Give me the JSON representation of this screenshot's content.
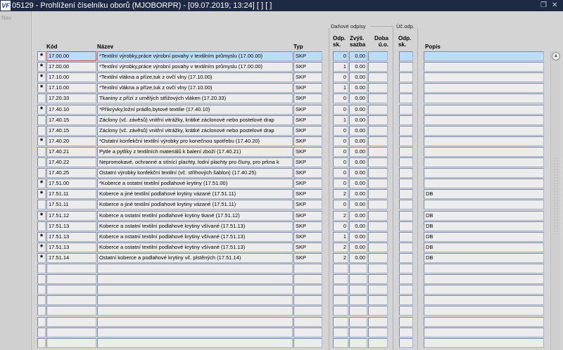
{
  "window": {
    "title": "05129 - Prohlížení číselníku oborů (MJOBORPR) - [09.07.2019; 13:24]  [ ]  [ ]",
    "logo": "VF",
    "restore_icon": "restore-icon",
    "close_icon": "close-icon"
  },
  "nav": {
    "label": "Nav"
  },
  "groups": {
    "danove": "Daňové odpisy",
    "uc": "Úč.odp."
  },
  "columns": {
    "kod": "Kód",
    "nazev": "Název",
    "typ": "Typ",
    "odp1": "Odp.",
    "odp2": "sk.",
    "zvys1": "Zvýš.",
    "zvys2": "sazba",
    "doba1": "Doba",
    "doba2": "ú.o.",
    "ucodp1": "Odp.",
    "ucodp2": "sk.",
    "popis": "Popis"
  },
  "rows": [
    {
      "star": "*",
      "kod": "17.00.00",
      "nazev": "*Textilní výrobky,práce výrobní povahy v textilním průmyslu (17.00.00)",
      "typ": "SKP",
      "odp": "0",
      "zvys": "0.00",
      "popis": ""
    },
    {
      "star": "*",
      "kod": "17.00.00",
      "nazev": "*Textilní výrobky,práce výrobní povahy v textilním průmyslu (17.00.00)",
      "typ": "SKP",
      "odp": "1",
      "zvys": "0.00",
      "popis": ""
    },
    {
      "star": "*",
      "kod": "17.10.00",
      "nazev": "*Textilní vlákna a příze,tuk z ovčí vlny (17.10.00)",
      "typ": "SKP",
      "odp": "0",
      "zvys": "0.00",
      "popis": ""
    },
    {
      "star": "*",
      "kod": "17.10.00",
      "nazev": "*Textilní vlákna a příze,tuk z ovčí vlny (17.10.00)",
      "typ": "SKP",
      "odp": "1",
      "zvys": "0.00",
      "popis": ""
    },
    {
      "star": "",
      "kod": "17.20.33",
      "nazev": "Tkaniny z přízí z umělých střižových vláken (17.20.33)",
      "typ": "SKP",
      "odp": "0",
      "zvys": "0.00",
      "popis": ""
    },
    {
      "star": "*",
      "kod": "17.40.10",
      "nazev": "*Přikrývky,ložní prádlo,bytové textilie (17.40.10)",
      "typ": "SKP",
      "odp": "0",
      "zvys": "0.00",
      "popis": ""
    },
    {
      "star": "",
      "kod": "17.40.15",
      "nazev": "Záclony (vč. závěsů) vnitřní vitrážky, krátké záclonové nebo postelové drap",
      "typ": "SKP",
      "odp": "1",
      "zvys": "0.00",
      "popis": ""
    },
    {
      "star": "",
      "kod": "17.40.15",
      "nazev": "Záclony (vč. závěsů) vnitřní vitrážky, krátké záclonové nebo postelové drap",
      "typ": "SKP",
      "odp": "0",
      "zvys": "0.00",
      "popis": ""
    },
    {
      "star": "*",
      "kod": "17.40.20",
      "nazev": "*Ostatní konfekční textilní výrobky pro konečnou spotřebu (17.40.20)",
      "typ": "SKP",
      "odp": "0",
      "zvys": "0.00",
      "popis": ""
    },
    {
      "star": "",
      "kod": "17.40.21",
      "nazev": "Pytle a pytlíky z textilních materiálů k balení zboží (17.40.21)",
      "typ": "SKP",
      "odp": "0",
      "zvys": "0.00",
      "popis": ""
    },
    {
      "star": "",
      "kod": "17.40.22",
      "nazev": "Nepromokavé, ochranné a stínící plachty, lodní plachty pro čluny, pro prkna k",
      "typ": "SKP",
      "odp": "0",
      "zvys": "0.00",
      "popis": ""
    },
    {
      "star": "",
      "kod": "17.40.25",
      "nazev": "Ostatní výrobky konfekční textilní (vč. střihových šablon) (17.40.25)",
      "typ": "SKP",
      "odp": "0",
      "zvys": "0.00",
      "popis": ""
    },
    {
      "star": "*",
      "kod": "17.51.00",
      "nazev": "*Koberce a ostatní textilní podlahové krytiny (17.51.00)",
      "typ": "SKP",
      "odp": "0",
      "zvys": "0.00",
      "popis": ""
    },
    {
      "star": "*",
      "kod": "17.51.11",
      "nazev": "Koberce a jiné textilní podlahové krytiny vázané (17.51.11)",
      "typ": "SKP",
      "odp": "2",
      "zvys": "0.00",
      "popis": "DB"
    },
    {
      "star": "",
      "kod": "17.51.11",
      "nazev": "Koberce a jiné textilní podlahové krytiny vázané (17.51.11)",
      "typ": "SKP",
      "odp": "0",
      "zvys": "0.00",
      "popis": ""
    },
    {
      "star": "*",
      "kod": "17.51.12",
      "nazev": "Koberce a ostatní textilní podlahové krytiny tkané (17.51.12)",
      "typ": "SKP",
      "odp": "2",
      "zvys": "0.00",
      "popis": "DB"
    },
    {
      "star": "",
      "kod": "17.51.13",
      "nazev": "Koberce a ostatní textilní podlahové krytiny všívané (17.51.13)",
      "typ": "SKP",
      "odp": "0",
      "zvys": "0.00",
      "popis": "DB"
    },
    {
      "star": "*",
      "kod": "17.51.13",
      "nazev": "Koberce a ostatní textilní podlahové krytiny všívané (17.51.13)",
      "typ": "SKP",
      "odp": "1",
      "zvys": "0.00",
      "popis": "DB"
    },
    {
      "star": "*",
      "kod": "17.51.13",
      "nazev": "Koberce a ostatní textilní podlahové krytiny všívané (17.51.13)",
      "typ": "SKP",
      "odp": "2",
      "zvys": "0.00",
      "popis": "DB"
    },
    {
      "star": "*",
      "kod": "17.51.14",
      "nazev": "Ostatní koberce a podlahové krytiny vč. plstěných (17.51.14)",
      "typ": "SKP",
      "odp": "2",
      "zvys": "0.00",
      "popis": "DB"
    }
  ],
  "colors": {
    "titlebar": "#1e2a44",
    "selected_row": "#bcdcfc",
    "focus_border": "#e04040"
  }
}
